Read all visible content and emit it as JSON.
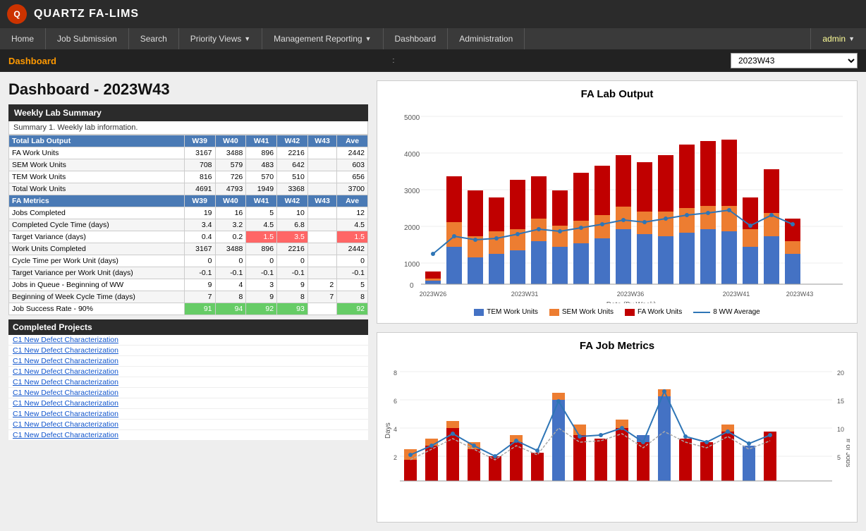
{
  "app": {
    "logo_text": "Q",
    "title": "QUARTZ FA-LIMS"
  },
  "nav": {
    "items": [
      {
        "label": "Home",
        "has_arrow": false
      },
      {
        "label": "Job Submission",
        "has_arrow": false
      },
      {
        "label": "Search",
        "has_arrow": false
      },
      {
        "label": "Priority Views",
        "has_arrow": true
      },
      {
        "label": "Management Reporting",
        "has_arrow": true
      },
      {
        "label": "Dashboard",
        "has_arrow": false
      },
      {
        "label": "Administration",
        "has_arrow": false
      }
    ],
    "user_label": "admin"
  },
  "breadcrumb": {
    "label": "Dashboard",
    "dots": ":",
    "week_value": "2023W43"
  },
  "page": {
    "title": "Dashboard - 2023W43",
    "weekly_lab_summary": "Weekly Lab Summary",
    "summary_desc": "Summary 1. Weekly lab information.",
    "completed_projects_header": "Completed Projects"
  },
  "table": {
    "header1": {
      "label": "Total Lab Output",
      "cols": [
        "W39",
        "W40",
        "W41",
        "W42",
        "W43",
        "Ave"
      ]
    },
    "rows1": [
      {
        "label": "FA Work Units",
        "vals": [
          "3167",
          "3488",
          "896",
          "2216",
          "",
          "2442"
        ]
      },
      {
        "label": "SEM Work Units",
        "vals": [
          "708",
          "579",
          "483",
          "642",
          "",
          "603"
        ]
      },
      {
        "label": "TEM Work Units",
        "vals": [
          "816",
          "726",
          "570",
          "510",
          "",
          "656"
        ]
      },
      {
        "label": "Total Work Units",
        "vals": [
          "4691",
          "4793",
          "1949",
          "3368",
          "",
          "3700"
        ]
      }
    ],
    "header2": {
      "label": "FA Metrics",
      "cols": [
        "W39",
        "W40",
        "W41",
        "W42",
        "W43",
        "Ave"
      ]
    },
    "rows2": [
      {
        "label": "Jobs Completed",
        "vals": [
          "19",
          "16",
          "5",
          "10",
          "",
          "12"
        ],
        "highlight": []
      },
      {
        "label": "Completed Cycle Time (days)",
        "vals": [
          "3.4",
          "3.2",
          "4.5",
          "6.8",
          "",
          "4.5"
        ],
        "highlight": []
      },
      {
        "label": "Target Variance (days)",
        "vals": [
          "0.4",
          "0.2",
          "1.5",
          "3.5",
          "",
          "1.5"
        ],
        "highlight": [
          false,
          false,
          true,
          true,
          false,
          true
        ]
      },
      {
        "label": "Work Units Completed",
        "vals": [
          "3167",
          "3488",
          "896",
          "2216",
          "",
          "2442"
        ],
        "highlight": []
      },
      {
        "label": "Cycle Time per Work Unit (days)",
        "vals": [
          "0",
          "0",
          "0",
          "0",
          "",
          "0"
        ],
        "highlight": []
      },
      {
        "label": "Target Variance per Work Unit (days)",
        "vals": [
          "-0.1",
          "-0.1",
          "-0.1",
          "-0.1",
          "",
          "-0.1"
        ],
        "highlight": []
      },
      {
        "label": "Jobs in Queue - Beginning of WW",
        "vals": [
          "9",
          "4",
          "3",
          "9",
          "2",
          "5"
        ],
        "highlight": []
      },
      {
        "label": "Beginning of Week Cycle Time (days)",
        "vals": [
          "7",
          "8",
          "9",
          "8",
          "7",
          "8"
        ],
        "highlight": []
      },
      {
        "label": "Job Success Rate - 90%",
        "vals": [
          "91",
          "94",
          "92",
          "93",
          "",
          "92"
        ],
        "highlight": [
          false,
          false,
          false,
          false,
          false,
          false
        ],
        "green": true
      }
    ]
  },
  "completed_projects": [
    "C1 New Defect Characterization",
    "C1 New Defect Characterization",
    "C1 New Defect Characterization",
    "C1 New Defect Characterization",
    "C1 New Defect Characterization",
    "C1 New Defect Characterization",
    "C1 New Defect Characterization",
    "C1 New Defect Characterization",
    "C1 New Defect Characterization",
    "C1 New Defect Characterization"
  ],
  "charts": {
    "fa_lab_output": {
      "title": "FA Lab Output",
      "x_label": "Date (By Week)",
      "legend": [
        "TEM Work Units",
        "SEM Work Units",
        "FA Work Units",
        "8 WW Average"
      ]
    },
    "fa_job_metrics": {
      "title": "FA Job Metrics",
      "y_label_left": "Days",
      "y_label_right": "# of Jobs"
    }
  },
  "colors": {
    "blue": "#4472c4",
    "orange": "#ed7d31",
    "red": "#c00000",
    "teal": "#2e75b6",
    "green": "#70ad47",
    "nav_bg": "#3a3a3a",
    "header_bg": "#2b2b2b",
    "table_header": "#4a7ab5"
  }
}
